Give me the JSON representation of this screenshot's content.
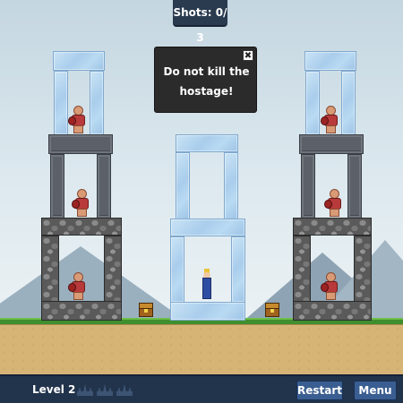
{
  "hud": {
    "shots_label": "Shots: 0/ 3",
    "level_label": "Level 2",
    "stars_total": 3,
    "restart_label": "Restart",
    "menu_label": "Menu"
  },
  "message": {
    "text": "Do not kill the hostage!",
    "close_glyph": "✖"
  },
  "icons": {
    "close": "close-icon",
    "crown": "crown-icon",
    "chest": "treasure-chest-icon"
  },
  "colors": {
    "hud_background": "#22344c",
    "button": "#3a5e91",
    "grass": "#3f8f2f",
    "ground": "#d6b476"
  }
}
